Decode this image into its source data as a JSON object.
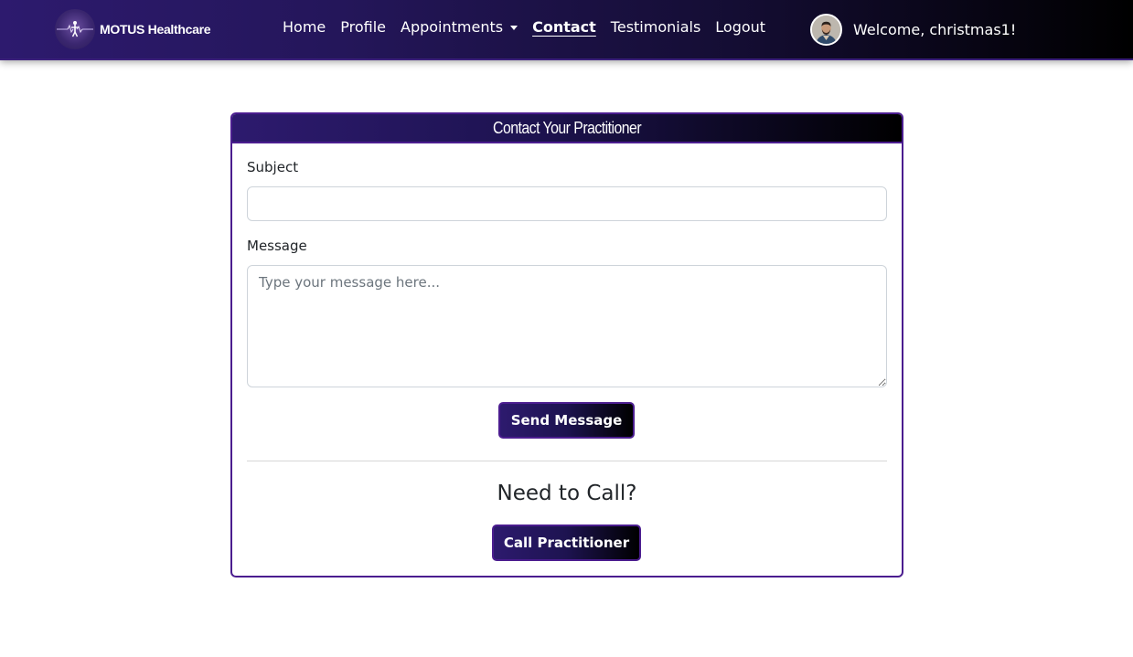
{
  "navbar": {
    "brand": {
      "logo_icon": "motus-logo-icon",
      "name": "MOTUS Healthcare"
    },
    "links": [
      {
        "label": "Home",
        "active": false
      },
      {
        "label": "Profile",
        "active": false
      },
      {
        "label": "Appointments",
        "active": false,
        "dropdown": true
      },
      {
        "label": "Contact",
        "active": true
      },
      {
        "label": "Testimonials",
        "active": false
      },
      {
        "label": "Logout",
        "active": false
      }
    ],
    "user": {
      "avatar_icon": "user-avatar",
      "welcome_text": "Welcome, christmas1!"
    }
  },
  "contact_card": {
    "title": "Contact Your Practitioner",
    "subject": {
      "label": "Subject",
      "value": "",
      "placeholder": ""
    },
    "message": {
      "label": "Message",
      "value": "",
      "placeholder": "Type your message here..."
    },
    "send_button_label": "Send Message",
    "call_heading": "Need to Call?",
    "call_button_label": "Call Practitioner"
  },
  "colors": {
    "brand_purple": "#4b1d8f",
    "gradient_start": "#2d1a6e",
    "gradient_end": "#000000"
  }
}
